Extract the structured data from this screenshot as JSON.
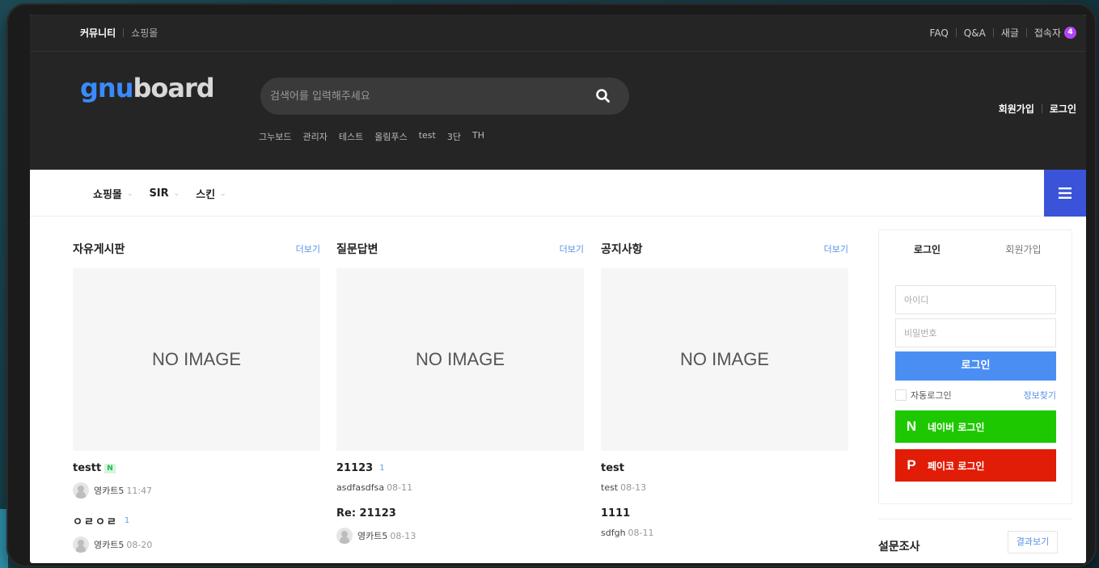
{
  "topbar": {
    "left": [
      "커뮤니티",
      "쇼핑몰"
    ],
    "right": [
      "FAQ",
      "Q&A",
      "새글",
      "접속자"
    ],
    "visitor_count": "4"
  },
  "header": {
    "logo_part1": "gnu",
    "logo_part2": "board",
    "search_placeholder": "검색어를 입력해주세요",
    "popular": [
      "그누보드",
      "관리자",
      "테스트",
      "올림푸스",
      "test",
      "3단",
      "TH"
    ],
    "join": "회원가입",
    "login": "로그인"
  },
  "gnb": {
    "items": [
      "쇼핑몰",
      "SIR",
      "스킨"
    ]
  },
  "boards": [
    {
      "title": "자유게시판",
      "more": "더보기",
      "noimage": "NO IMAGE",
      "posts": [
        {
          "title": "testt",
          "new": "N",
          "author": "영카트5",
          "date": "11:47"
        },
        {
          "title": "ㅇㄹㅇㄹ",
          "count": "1",
          "author": "영카트5",
          "date": "08-20"
        }
      ]
    },
    {
      "title": "질문답변",
      "more": "더보기",
      "noimage": "NO IMAGE",
      "posts": [
        {
          "title": "21123",
          "count": "1",
          "author": "asdfasdfsa",
          "date": "08-11"
        },
        {
          "title": "Re: 21123",
          "author": "영카트5",
          "date": "08-13"
        }
      ]
    },
    {
      "title": "공지사항",
      "more": "더보기",
      "noimage": "NO IMAGE",
      "posts": [
        {
          "title": "test",
          "author": "test",
          "date": "08-13"
        },
        {
          "title": "1111",
          "author": "sdfgh",
          "date": "08-11"
        }
      ]
    }
  ],
  "side": {
    "tab_login": "로그인",
    "tab_join": "회원가입",
    "id_placeholder": "아이디",
    "pw_placeholder": "비밀번호",
    "login_button": "로그인",
    "auto_login": "자동로그인",
    "find_info": "정보찾기",
    "naver_label": "네이버 로그인",
    "naver_logo": "N",
    "kakao_label": "페이코 로그인",
    "kakao_logo": "P"
  },
  "poll": {
    "title": "설문조사",
    "result_button": "결과보기"
  },
  "colors": {
    "accent": "#3a53d9",
    "login_button": "#4b8ef3",
    "naver": "#1ec800",
    "kakao": "#e11c07",
    "badge": "#b245f3"
  }
}
